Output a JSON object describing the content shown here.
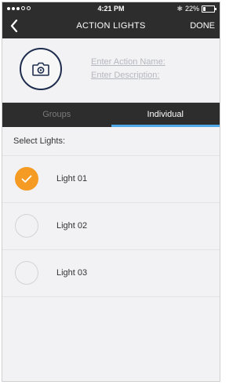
{
  "status": {
    "time": "4:21 PM",
    "battery": "22%"
  },
  "nav": {
    "title": "ACTION LIGHTS",
    "done": "DONE"
  },
  "form": {
    "name_placeholder": "Enter Action Name:",
    "description_placeholder": "Enter Description:"
  },
  "tabs": [
    {
      "label": "Groups",
      "active": false
    },
    {
      "label": "Individual",
      "active": true
    }
  ],
  "section": {
    "label": "Select Lights:"
  },
  "lights": [
    {
      "label": "Light 01",
      "selected": true
    },
    {
      "label": "Light 02",
      "selected": false
    },
    {
      "label": "Light 03",
      "selected": false
    }
  ],
  "colors": {
    "accent": "#f59a23",
    "tab_indicator": "#4fa9e8",
    "bar": "#2d2d2d",
    "icon_ring": "#1e2d4e"
  }
}
